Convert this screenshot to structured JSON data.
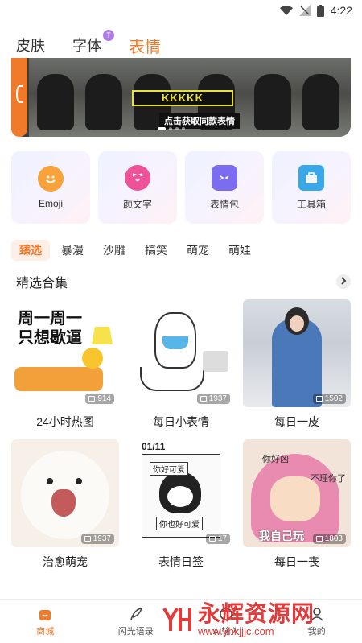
{
  "status_bar": {
    "time": "4:22"
  },
  "top_tabs": [
    {
      "label": "皮肤",
      "active": false
    },
    {
      "label": "字体",
      "active": false,
      "badge": "T"
    },
    {
      "label": "表情",
      "active": true
    }
  ],
  "banner": {
    "tag_text": "KKKKK",
    "cta_text": "点击获取同款表情"
  },
  "tools": [
    {
      "label": "Emoji",
      "icon": "smiley-face-icon",
      "color": "#f7a23a"
    },
    {
      "label": "颜文字",
      "icon": "kaomoji-face-icon",
      "color": "#f0529a"
    },
    {
      "label": "表情包",
      "icon": "sticker-pack-icon",
      "color": "#7c6cf0"
    },
    {
      "label": "工具箱",
      "icon": "toolbox-icon",
      "color": "#3aa8e8"
    }
  ],
  "categories": [
    {
      "label": "臻选",
      "active": true
    },
    {
      "label": "暴漫",
      "active": false
    },
    {
      "label": "沙雕",
      "active": false
    },
    {
      "label": "搞笑",
      "active": false
    },
    {
      "label": "萌宠",
      "active": false
    },
    {
      "label": "萌娃",
      "active": false
    }
  ],
  "section": {
    "title": "精选合集"
  },
  "cards": [
    {
      "title": "24小时热图",
      "count": "914",
      "image_text": "周一周一\n只想歇逼"
    },
    {
      "title": "每日小表情",
      "count": "1937"
    },
    {
      "title": "每日一皮",
      "count": "1502"
    },
    {
      "title": "治愈萌宠",
      "count": "1937"
    },
    {
      "title": "表情日签",
      "count": "17",
      "date": "01/11",
      "bubble_top": "你好可爱",
      "bubble_bottom": "你也好可爱"
    },
    {
      "title": "每日一丧",
      "count": "1803",
      "text_top": "你好凶",
      "text_right": "不理你了",
      "text_bottom": "我自己玩"
    }
  ],
  "bottom_nav": [
    {
      "label": "商城",
      "active": true
    },
    {
      "label": "闪光语录",
      "active": false
    },
    {
      "label": "AI输入",
      "active": false
    },
    {
      "label": "我的",
      "active": false
    }
  ],
  "watermark": {
    "title": "永辉资源网",
    "url": "www.yhkjjjc.com"
  },
  "colors": {
    "accent": "#f07a2a"
  }
}
